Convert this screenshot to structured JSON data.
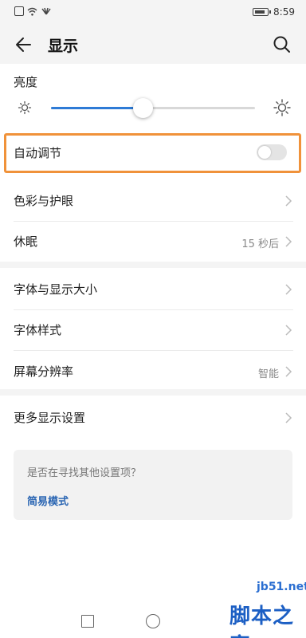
{
  "status_bar": {
    "time": "8:59"
  },
  "header": {
    "title": "显示"
  },
  "brightness": {
    "label": "亮度",
    "level": 0.45
  },
  "auto_adjust": {
    "label": "自动调节",
    "enabled": false
  },
  "group1": {
    "items": [
      {
        "label": "色彩与护眼",
        "value": ""
      },
      {
        "label": "休眠",
        "value": "15 秒后"
      }
    ]
  },
  "group2": {
    "items": [
      {
        "label": "字体与显示大小",
        "value": ""
      },
      {
        "label": "字体样式",
        "value": ""
      },
      {
        "label": "屏幕分辨率",
        "value": "智能"
      }
    ]
  },
  "group3": {
    "items": [
      {
        "label": "更多显示设置",
        "value": ""
      }
    ]
  },
  "suggestion": {
    "question": "是否在寻找其他设置项？",
    "link": "简易模式"
  },
  "watermark": {
    "site": "jb51.net",
    "text": "脚本之家"
  },
  "colors": {
    "accent": "#2e7bd6",
    "highlight": "#f0923a",
    "link": "#2b66b3"
  }
}
